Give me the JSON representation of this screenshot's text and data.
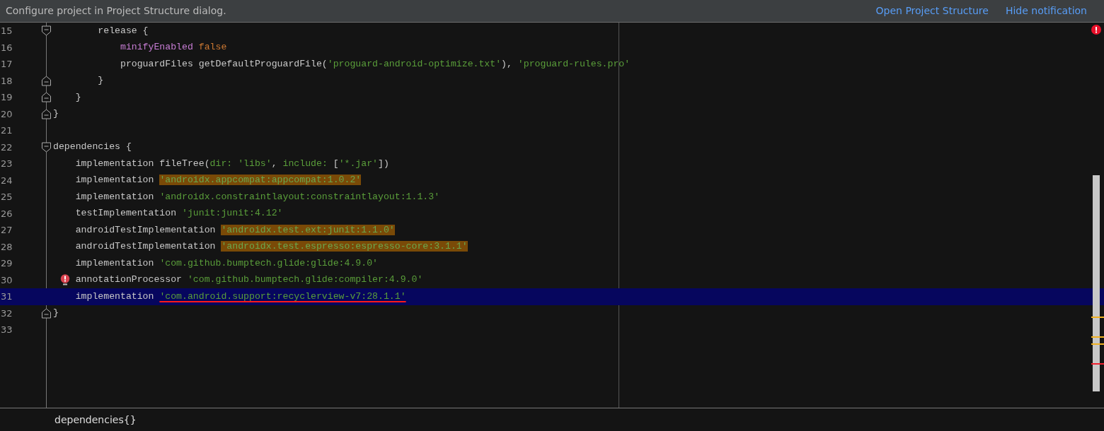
{
  "notification": {
    "message": "Configure project in Project Structure dialog.",
    "actions": [
      "Open Project Structure",
      "Hide notification"
    ]
  },
  "lines": [
    {
      "number": "15",
      "kind": "block-start",
      "selected": false,
      "warning": false,
      "tokens": [
        {
          "text": "        release {",
          "kind": "plain"
        }
      ]
    },
    {
      "number": "16",
      "kind": "plain",
      "selected": false,
      "warning": false,
      "tokens": [
        {
          "text": "            minifyEnabled",
          "kind": "keyword"
        },
        {
          "text": " false",
          "kind": "literal"
        }
      ]
    },
    {
      "number": "17",
      "kind": "plain",
      "selected": false,
      "warning": false,
      "tokens": [
        {
          "text": "            proguardFiles getDefaultProguardFile(",
          "kind": "plain"
        },
        {
          "text": "'proguard-android-optimize.txt'",
          "kind": "string"
        },
        {
          "text": "), ",
          "kind": "plain"
        },
        {
          "text": "'proguard-rules.pro'",
          "kind": "string"
        }
      ]
    },
    {
      "number": "18",
      "kind": "block-end",
      "selected": false,
      "warning": false,
      "tokens": [
        {
          "text": "        }",
          "kind": "plain"
        }
      ]
    },
    {
      "number": "19",
      "kind": "block-end",
      "selected": false,
      "warning": false,
      "tokens": [
        {
          "text": "    }",
          "kind": "plain"
        }
      ]
    },
    {
      "number": "20",
      "kind": "block-end",
      "selected": false,
      "warning": false,
      "tokens": [
        {
          "text": "}",
          "kind": "plain"
        }
      ]
    },
    {
      "number": "21",
      "kind": "plain",
      "selected": false,
      "warning": false
    },
    {
      "number": "22",
      "kind": "block-start",
      "selected": false,
      "warning": false,
      "tokens": [
        {
          "text": "dependencies {",
          "kind": "plain"
        }
      ]
    },
    {
      "number": "23",
      "kind": "plain",
      "selected": false,
      "warning": false,
      "tokens": [
        {
          "text": "    implementation fileTree(",
          "kind": "plain"
        },
        {
          "text": "dir:",
          "kind": "param"
        },
        {
          "text": " 'libs'",
          "kind": "string"
        },
        {
          "text": ", ",
          "kind": "plain"
        },
        {
          "text": "include:",
          "kind": "param"
        },
        {
          "text": " [",
          "kind": "plain"
        },
        {
          "text": "'*.jar'",
          "kind": "string"
        },
        {
          "text": "])",
          "kind": "plain"
        }
      ]
    },
    {
      "number": "24",
      "kind": "plain",
      "selected": false,
      "warning": false,
      "tokens": [
        {
          "text": "    implementation ",
          "kind": "plain"
        },
        {
          "text": "'androidx.appcompat:appcompat:1.0.2'",
          "kind": "outdated"
        }
      ]
    },
    {
      "number": "25",
      "kind": "plain",
      "selected": false,
      "warning": false,
      "tokens": [
        {
          "text": "    implementation ",
          "kind": "plain"
        },
        {
          "text": "'androidx.constraintlayout:constraintlayout:1.1.3'",
          "kind": "string"
        }
      ]
    },
    {
      "number": "26",
      "kind": "plain",
      "selected": false,
      "warning": false,
      "tokens": [
        {
          "text": "    testImplementation ",
          "kind": "plain"
        },
        {
          "text": "'junit:junit:4.12'",
          "kind": "string"
        }
      ]
    },
    {
      "number": "27",
      "kind": "plain",
      "selected": false,
      "warning": false,
      "tokens": [
        {
          "text": "    androidTestImplementation ",
          "kind": "plain"
        },
        {
          "text": "'androidx.test.ext:junit:1.1.0'",
          "kind": "outdated"
        }
      ]
    },
    {
      "number": "28",
      "kind": "plain",
      "selected": false,
      "warning": false,
      "tokens": [
        {
          "text": "    androidTestImplementation ",
          "kind": "plain"
        },
        {
          "text": "'androidx.test.espresso:espresso-core:3.1.1'",
          "kind": "outdated"
        }
      ]
    },
    {
      "number": "29",
      "kind": "plain",
      "selected": false,
      "warning": false,
      "tokens": [
        {
          "text": "    implementation ",
          "kind": "plain"
        },
        {
          "text": "'com.github.bumptech.glide:glide:4.9.0'",
          "kind": "string"
        }
      ]
    },
    {
      "number": "30",
      "kind": "plain",
      "selected": false,
      "warning": true,
      "tokens": [
        {
          "text": "    annotationProcessor ",
          "kind": "plain"
        },
        {
          "text": "'com.github.bumptech.glide:compiler:4.9.0'",
          "kind": "string"
        }
      ]
    },
    {
      "number": "31",
      "kind": "plain",
      "selected": true,
      "warning": false,
      "tokens": [
        {
          "text": "    implementation ",
          "kind": "plain"
        },
        {
          "text": "'com.android.support:recyclerview-v7:28.1.1'",
          "kind": "error"
        }
      ]
    },
    {
      "number": "32",
      "kind": "block-end",
      "selected": false,
      "warning": false,
      "tokens": [
        {
          "text": "}",
          "kind": "plain"
        }
      ]
    },
    {
      "number": "33",
      "kind": "plain",
      "selected": false,
      "warning": false
    }
  ],
  "breadcrumb": "dependencies{}"
}
